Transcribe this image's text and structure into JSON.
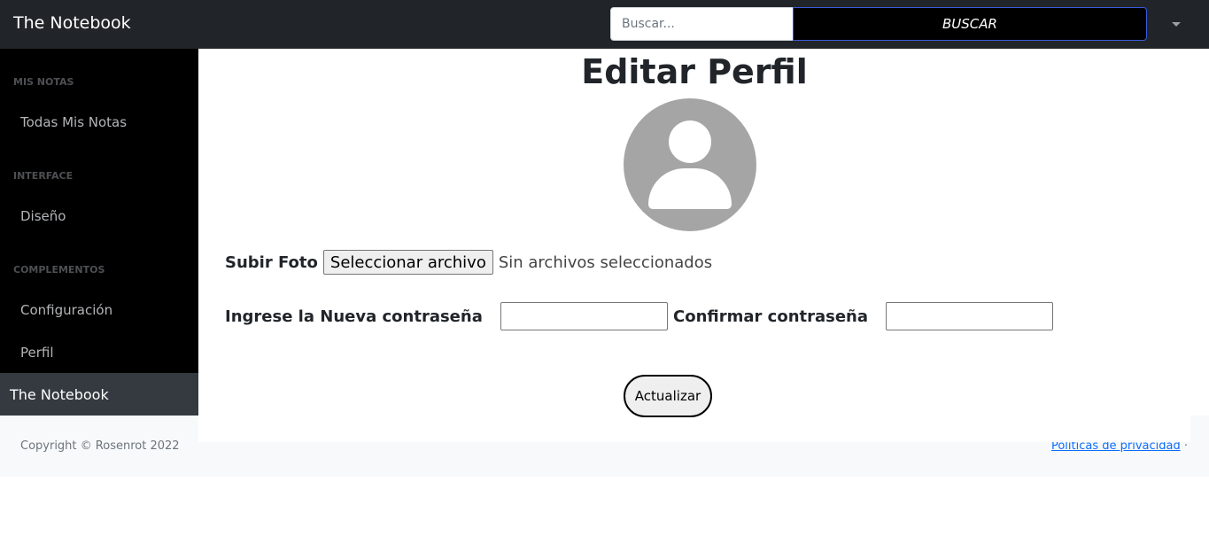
{
  "app": {
    "brand": "The Notebook"
  },
  "search": {
    "placeholder": "Buscar...",
    "value": "",
    "button_label": "BUSCAR"
  },
  "sidebar": {
    "sections": [
      {
        "heading": "MIS NOTAS",
        "items": [
          {
            "label": "Todas Mis Notas"
          }
        ]
      },
      {
        "heading": "INTERFACE",
        "items": [
          {
            "label": "Diseño"
          }
        ]
      },
      {
        "heading": "COMPLEMENTOS",
        "items": [
          {
            "label": "Configuración"
          },
          {
            "label": "Perfil"
          }
        ]
      }
    ],
    "footer": "The Notebook"
  },
  "main": {
    "title": "Editar Perfil",
    "photo": {
      "label": "Subir Foto",
      "button": "Seleccionar archivo",
      "status": "Sin archivos seleccionados"
    },
    "new_password": {
      "label": "Ingrese la Nueva contraseña",
      "value": ""
    },
    "confirm_password": {
      "label": "Confirmar contraseña",
      "value": ""
    },
    "submit": "Actualizar"
  },
  "footer": {
    "copyright": "Copyright © Rosenrot 2022",
    "privacy": "Politicas de privacidad",
    "separator": "·"
  },
  "colors": {
    "navbar": "#212529",
    "sidebar": "#000000",
    "sidebar_footer": "#343a40",
    "link": "#0d6efd",
    "avatar": "#a5a5a5"
  }
}
